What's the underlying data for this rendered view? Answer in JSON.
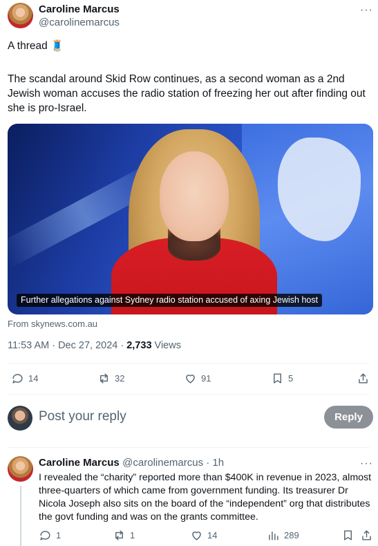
{
  "tweet": {
    "author_name": "Caroline Marcus",
    "author_handle": "@carolinemarcus",
    "more_label": "···",
    "line1": "A thread 🧵",
    "body": "The scandal around Skid Row continues, as a second woman as a 2nd Jewish woman accuses the radio station of freezing her out after finding out she is pro-Israel.",
    "media_caption": "Further allegations against Sydney radio station accused of axing Jewish host",
    "source": "From skynews.com.au",
    "time": "11:53 AM · Dec 27, 2024 · ",
    "views_count": "2,733",
    "views_label": " Views",
    "stats": {
      "replies": "14",
      "reposts": "32",
      "likes": "91",
      "bookmarks": "5"
    }
  },
  "composer": {
    "placeholder": "Post your reply",
    "button": "Reply"
  },
  "reply": {
    "author_name": "Caroline Marcus",
    "meta": "@carolinemarcus · 1h",
    "more_label": "···",
    "body": "I revealed the “charity” reported more than $400K in revenue in 2023, almost three-quarters of which came from government funding. Its treasurer Dr Nicola Joseph also sits on the board of the “independent” org that distributes the govt funding and was on the grants committee.",
    "stats": {
      "replies": "1",
      "reposts": "1",
      "likes": "14",
      "views": "289"
    }
  },
  "colors": {
    "text": "#0f1419",
    "muted": "#536471",
    "divider": "#eff3f4",
    "reply_button": "#8b9197"
  }
}
